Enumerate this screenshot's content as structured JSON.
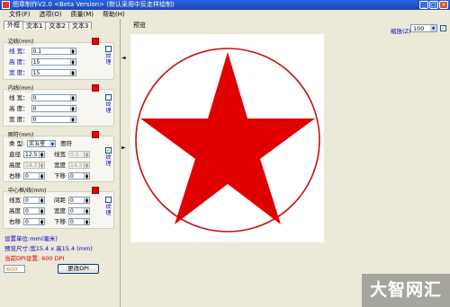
{
  "window": {
    "title": "图章制作V2.0  <Beta Version>  (默认采用中反走样绘制)",
    "min": "_",
    "max": "□",
    "close": "×"
  },
  "menu": [
    "文件(F)",
    "选项(O)",
    "质量(M)",
    "帮助(H)"
  ],
  "tabs": [
    "外框",
    "文本1",
    "文本2",
    "文本3"
  ],
  "outer": {
    "label": "边线(mm)",
    "rows": [
      {
        "label": "线  宽：",
        "value": "0.1"
      },
      {
        "label": "高  度：",
        "value": "15"
      },
      {
        "label": "宽  度：",
        "value": "15"
      }
    ],
    "texture_label": "纹理"
  },
  "inner": {
    "label": "内线(mm)",
    "rows": [
      {
        "label": "线  宽：",
        "value": "0"
      },
      {
        "label": "高  度：",
        "value": "0"
      },
      {
        "label": "宽  度：",
        "value": "0"
      }
    ],
    "texture_label": "纹理"
  },
  "pattern": {
    "label": "图符(mm)",
    "type_label": "类  型:",
    "type_value": "实五星",
    "pattern_button": "图符",
    "diameter_label": "直径",
    "diameter_value": "12.5",
    "linewidth_label": "线宽",
    "linewidth_value": "0.1",
    "height_label": "高度",
    "height_value": "14.3",
    "width_label": "宽度",
    "width_value": "14.3",
    "right_label": "右移",
    "right_value": "0",
    "down_label": "下移",
    "down_value": "0",
    "texture_label": "纹理",
    "checked": "✓"
  },
  "center": {
    "label": "中心框/线(mm)",
    "linewidth_label": "线宽",
    "linewidth_value": "0",
    "spacing_label": "间距",
    "spacing_value": "0",
    "height_label": "高度",
    "height_value": "0",
    "width_label": "宽度",
    "width_value": "0",
    "right_label": "右移",
    "right_value": "0",
    "down_label": "下移",
    "down_value": "0",
    "texture_label": "纹理"
  },
  "info": {
    "unit": "设置单位:mm(毫米)",
    "size": "预览尺寸:宽15.4 x 高15.4 (mm)",
    "dpi": "当前DPI设置: 600 DPI",
    "dpi_input": "600",
    "dpi_button": "更改DPI"
  },
  "splitter": {
    "left_arrow": "◄",
    "right_arrow": "►"
  },
  "preview": {
    "label": "预览",
    "zoom_label": "缩放(Z)",
    "zoom_value": "100",
    "zoom_unit": "%",
    "zoom_check": "✓"
  },
  "colors": {
    "stamp_red": "#e00000",
    "border_red": "#cc1111"
  },
  "watermark": "大智网汇"
}
